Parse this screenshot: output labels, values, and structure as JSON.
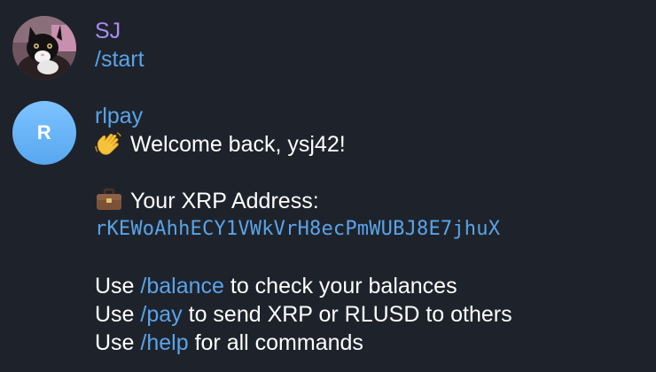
{
  "user_message": {
    "sender": "SJ",
    "sender_color": "#a98cf0",
    "text": "/start"
  },
  "bot_message": {
    "sender": "rlpay",
    "avatar_initial": "R",
    "avatar_color": "#6db7f8",
    "welcome_emoji": "waving-hand-icon",
    "welcome_text": "Welcome back, ysj42!",
    "address_emoji": "briefcase-icon",
    "address_label": "Your XRP Address:",
    "address_value": "rKEWoAhhECY1VWkVrH8ecPmWUBJ8E7jhuX",
    "commands": [
      {
        "prefix": "Use ",
        "command": "/balance",
        "suffix": " to check your balances"
      },
      {
        "prefix": "Use ",
        "command": "/pay",
        "suffix": " to send XRP or RLUSD to others"
      },
      {
        "prefix": "Use ",
        "command": "/help",
        "suffix": " for all commands"
      }
    ]
  },
  "colors": {
    "background": "#1e232b",
    "link": "#5aa3e8",
    "text": "#ffffff"
  }
}
